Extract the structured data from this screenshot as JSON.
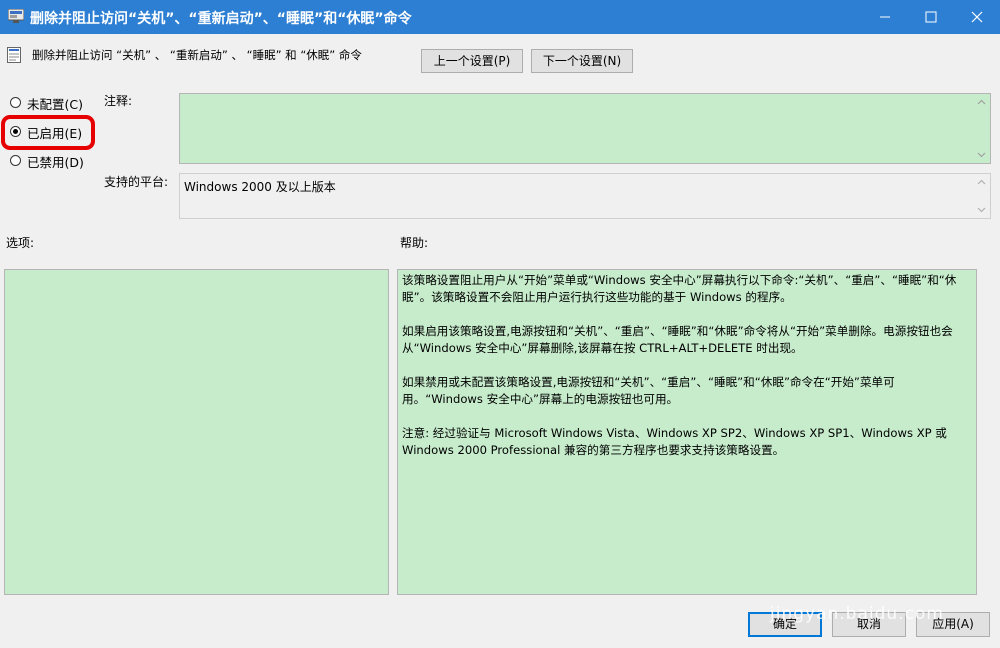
{
  "window": {
    "title": "删除并阻止访问“关机”、“重新启动”、“睡眠”和“休眠”命令",
    "controls": [
      "minimize",
      "maximize",
      "close"
    ]
  },
  "header": {
    "setting_name": "删除并阻止访问 “关机” 、 “重新启动” 、 “睡眠” 和 “休眠” 命令",
    "prev_button": "上一个设置(P)",
    "next_button": "下一个设置(N)"
  },
  "state_options": [
    {
      "label": "未配置(C)",
      "selected": false
    },
    {
      "label": "已启用(E)",
      "selected": true
    },
    {
      "label": "已禁用(D)",
      "selected": false
    }
  ],
  "comment": {
    "label": "注释:",
    "value": ""
  },
  "platform": {
    "label": "支持的平台:",
    "value": "Windows 2000 及以上版本"
  },
  "options": {
    "label": "选项:"
  },
  "help": {
    "label": "帮助:",
    "paragraphs": [
      "该策略设置阻止用户从“开始”菜单或“Windows 安全中心”屏幕执行以下命令:“关机”、“重启”、“睡眠”和“休眠”。该策略设置不会阻止用户运行执行这些功能的基于 Windows 的程序。",
      "如果启用该策略设置,电源按钮和“关机”、“重启”、“睡眠”和“休眠”命令将从“开始”菜单删除。电源按钮也会从“Windows 安全中心”屏幕删除,该屏幕在按 CTRL+ALT+DELETE 时出现。",
      "如果禁用或未配置该策略设置,电源按钮和“关机”、“重启”、“睡眠”和“休眠”命令在“开始”菜单可用。“Windows 安全中心”屏幕上的电源按钮也可用。",
      "注意: 经过验证与 Microsoft Windows Vista、Windows XP SP2、Windows XP SP1、Windows XP 或 Windows 2000 Professional 兼容的第三方程序也要求支持该策略设置。"
    ]
  },
  "footer": {
    "ok_button": "确定",
    "cancel_button": "取消",
    "apply_button": "应用(A)"
  },
  "watermark": "jingyan.baidu.com",
  "colors": {
    "titlebar": "#2d7fd3",
    "field_green": "#c7eccc",
    "highlight": "#e60000",
    "focus_border": "#0078d7"
  }
}
